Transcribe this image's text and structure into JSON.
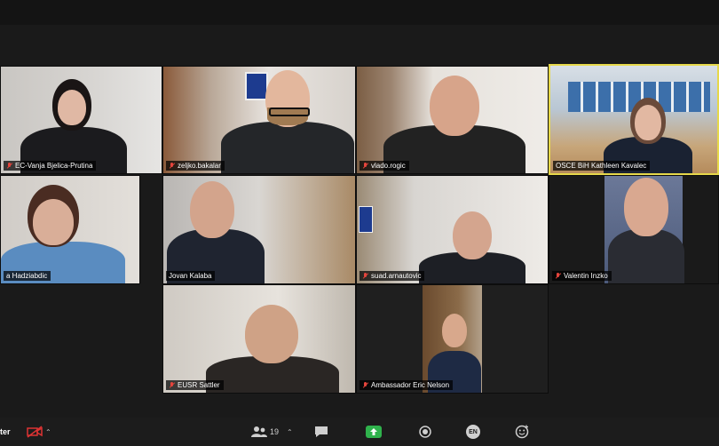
{
  "meeting": {
    "participants": [
      {
        "name": "EC-Vanja Bjelica-Prutina",
        "label": "EC-Vanja Bjelica-Prutina"
      },
      {
        "name": "zeljko.bakalar",
        "label": "zeljko.bakalar"
      },
      {
        "name": "vlado.rogic",
        "label": "vlado.rogic"
      },
      {
        "name": "OSCE BiH Kathleen Kavalec",
        "label": "OSCE BiH Kathleen Kavalec"
      },
      {
        "name": "Hadziabdic",
        "label": "a Hadziabdic"
      },
      {
        "name": "Jovan Kalaba",
        "label": "Jovan Kalaba"
      },
      {
        "name": "suad.arnautovic",
        "label": "suad.arnautovic"
      },
      {
        "name": "Valentin Inzko",
        "label": "Valentin Inzko"
      },
      {
        "name": "EUSR Sattler",
        "label": "EUSR Sattler"
      },
      {
        "name": "Ambassador Eric Nelson",
        "label": "Ambassador Eric Nelson"
      }
    ]
  },
  "toolbar": {
    "left_label": "ter",
    "participants_count": "19",
    "language_label": "EN"
  },
  "colors": {
    "active_speaker_border": "#e6d84a",
    "muted_mic": "#e5453c",
    "share_green": "#2fb24c"
  }
}
